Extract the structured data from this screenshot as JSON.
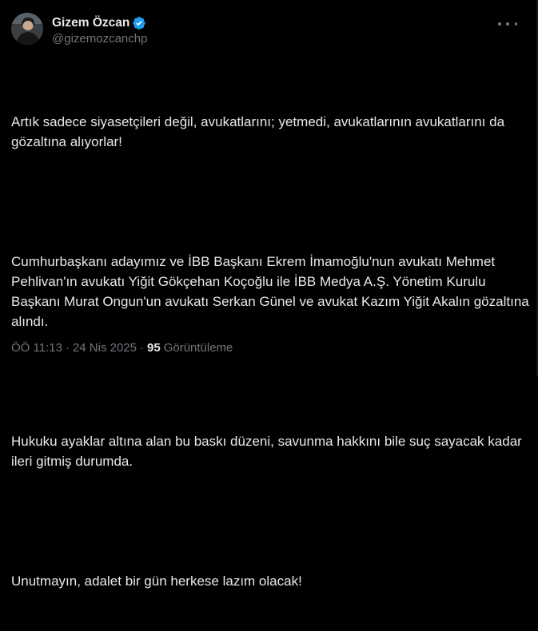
{
  "author": {
    "display_name": "Gizem Özcan",
    "handle": "@gizemozcanchp",
    "verified": true,
    "verified_color": "#1d9bf0"
  },
  "icons": {
    "more": "more-horizontal-icon",
    "verified": "verified-badge-icon"
  },
  "tweet": {
    "paragraphs": [
      "Artık sadece siyasetçileri değil, avukatlarını; yetmedi, avukatlarının avukatlarını da gözaltına alıyorlar!",
      "Cumhurbaşkanı adayımız ve İBB Başkanı Ekrem İmamoğlu'nun avukatı Mehmet Pehlivan'ın avukatı Yiğit Gökçehan Koçoğlu ile İBB Medya A.Ş. Yönetim Kurulu Başkanı Murat Ongun'un avukatı Serkan Günel ve avukat Kazım Yiğit Akalın gözaltına alındı.",
      "Hukuku ayaklar altına alan bu baskı düzeni, savunma hakkını bile suç sayacak kadar ileri gitmiş durumda.",
      "Unutmayın, adalet bir gün herkese lazım olacak!"
    ]
  },
  "meta": {
    "time": "ÖÖ 11:13",
    "separator": "·",
    "date": "24 Nis 2025",
    "views_count": "95",
    "views_label": "Görüntüleme"
  }
}
